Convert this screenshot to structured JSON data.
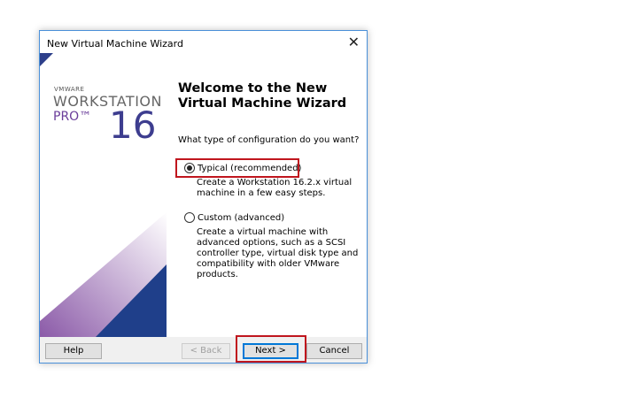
{
  "window": {
    "title": "New Virtual Machine Wizard"
  },
  "logo": {
    "brand": "VMWARE",
    "product": "WORKSTATION",
    "edition": "PRO™",
    "version": "16"
  },
  "main": {
    "heading": "Welcome to the New Virtual Machine Wizard",
    "question": "What type of configuration do you want?",
    "options": [
      {
        "label": "Typical (recommended)",
        "selected": true,
        "description": "Create a Workstation 16.2.x virtual machine in a few easy steps."
      },
      {
        "label": "Custom (advanced)",
        "selected": false,
        "description": "Create a virtual machine with advanced options, such as a SCSI controller type, virtual disk type and compatibility with older VMware products."
      }
    ]
  },
  "footer": {
    "help": "Help",
    "back": "< Back",
    "next": "Next >",
    "cancel": "Cancel"
  },
  "colors": {
    "highlight": "#c0161e",
    "accent": "#0078d7"
  }
}
